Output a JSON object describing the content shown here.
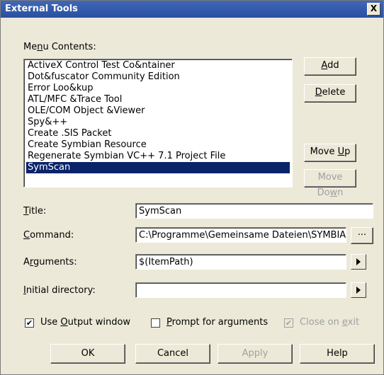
{
  "window": {
    "title": "External Tools",
    "close_glyph": "X"
  },
  "menu_contents": {
    "label_pre": "Me",
    "label_u": "n",
    "label_post": "u Contents:",
    "items": [
      "ActiveX Control Test Co&ntainer",
      "Dot&fuscator Community Edition",
      "Error Loo&kup",
      "ATL/MFC &Trace Tool",
      "OLE/COM Object &Viewer",
      "Spy&++",
      "Create .SIS Packet",
      "Create Symbian Resource",
      "Regenerate Symbian VC++ 7.1 Project File",
      "SymScan"
    ],
    "selected_index": 9
  },
  "side_buttons": {
    "add": {
      "u": "A",
      "rest": "dd"
    },
    "delete": {
      "u": "D",
      "rest": "elete"
    },
    "move_up": {
      "pre": "Move ",
      "u": "U",
      "rest": "p"
    },
    "move_down": {
      "pre": "Move Do",
      "u": "w",
      "rest": "n"
    }
  },
  "fields": {
    "title": {
      "u": "T",
      "rest": "itle:",
      "value": "SymScan"
    },
    "command": {
      "u": "C",
      "rest": "ommand:",
      "value": "C:\\Programme\\Gemeinsame Dateien\\SYMBIA",
      "browse": "..."
    },
    "arguments": {
      "pre": "A",
      "u": "r",
      "rest": "guments:",
      "value": "$(ItemPath)"
    },
    "initial_directory": {
      "u": "I",
      "rest": "nitial directory:",
      "value": ""
    }
  },
  "checks": {
    "use_output": {
      "pre": "Use ",
      "u": "O",
      "rest": "utput window",
      "checked": "✔"
    },
    "prompt_args": {
      "u": "P",
      "rest": "rompt for arguments",
      "checked": ""
    },
    "close_on_exit": {
      "pre": "Close on ",
      "u": "e",
      "rest": "xit",
      "checked": "✔"
    }
  },
  "buttons": {
    "ok": "OK",
    "cancel": "Cancel",
    "apply": "Apply",
    "help": "Help"
  }
}
